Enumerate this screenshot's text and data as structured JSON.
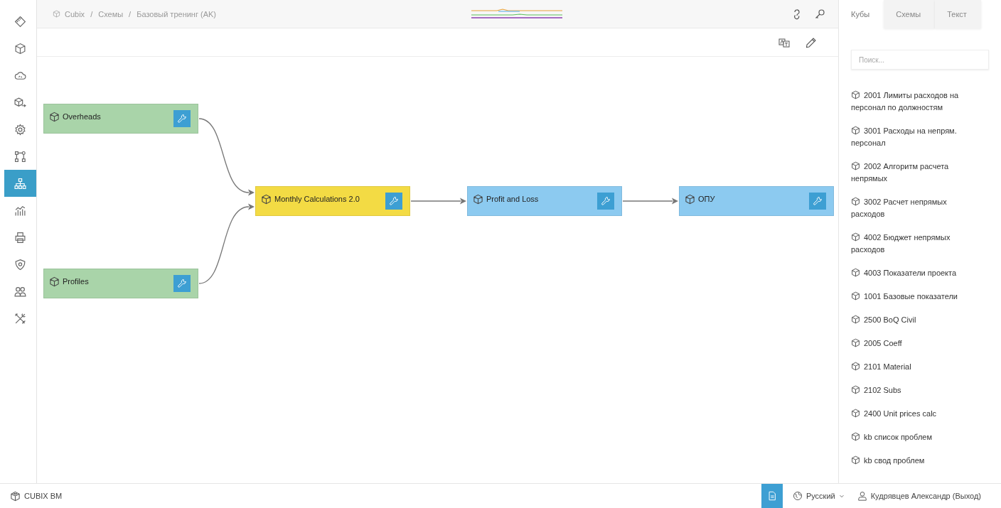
{
  "sidebar": {
    "items": [
      {
        "selected": false
      },
      {
        "selected": false
      },
      {
        "selected": false
      },
      {
        "selected": false
      },
      {
        "selected": false
      },
      {
        "selected": false
      },
      {
        "selected": true
      },
      {
        "selected": false
      },
      {
        "selected": false
      },
      {
        "selected": false
      },
      {
        "selected": false
      },
      {
        "selected": false
      }
    ]
  },
  "breadcrumb": {
    "items": [
      "Cubix",
      "Схемы",
      "Базовый тренинг (AK)"
    ],
    "separators": [
      "/",
      "/"
    ]
  },
  "flow": {
    "columns": [
      {
        "nodes": [
          {
            "name": "Overheads",
            "color": "#a9d4a9",
            "has_output": true
          },
          {
            "name": "Profiles",
            "color": "#a9d4a9",
            "has_output": true
          }
        ]
      },
      {
        "nodes": [
          {
            "name": "Monthly Calculations 2.0",
            "color": "#f3db44",
            "has_output": true
          }
        ]
      },
      {
        "nodes": [
          {
            "name": "Profit and Loss",
            "color": "#8ccaf0",
            "has_output": true
          }
        ]
      },
      {
        "nodes": [
          {
            "name": "ОПУ",
            "color": "#8ccaf0",
            "has_output": false
          }
        ]
      }
    ]
  },
  "panel": {
    "tabs": [
      {
        "label": "Кубы",
        "selected": true
      },
      {
        "label": "Схемы",
        "selected": false
      },
      {
        "label": "Текст",
        "selected": false
      }
    ],
    "search": {
      "placeholder": "Поиск..."
    },
    "items": [
      "2001 Лимиты расходов на персонал по должностям",
      "3001 Расходы на непрям. персонал",
      "2002 Алгоритм расчета непрямых",
      "3002 Расчет непрямых расходов",
      "4002 Бюджет непрямых расходов",
      "4003 Показатели проекта",
      "1001 Базовые показатели",
      "2500 BoQ Civil",
      "2005 Coeff",
      "2101 Material",
      "2102 Subs",
      "2400 Unit prices calc",
      "kb список проблем",
      "kb свод проблем"
    ]
  },
  "status_bar": {
    "brand": "CUBIX BM",
    "language": "Русский",
    "user": "Кудрявцев Александр (Выход)"
  }
}
